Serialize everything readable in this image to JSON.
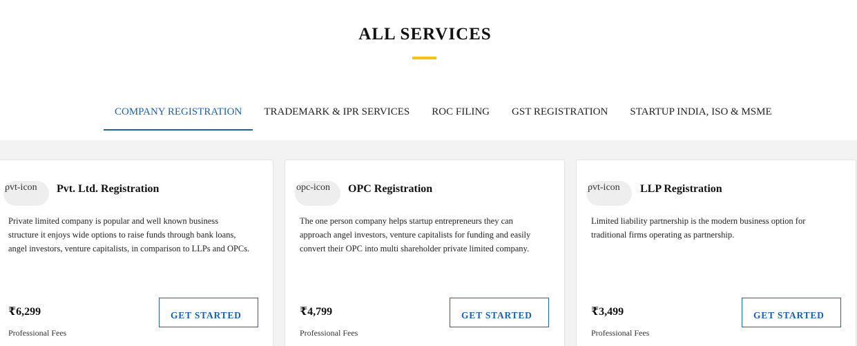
{
  "section": {
    "title": "ALL SERVICES",
    "accent_color": "#f5c400",
    "link_color": "#1a5fb4"
  },
  "tabs": [
    {
      "label": "COMPANY REGISTRATION",
      "active": true
    },
    {
      "label": "TRADEMARK & IPR SERVICES",
      "active": false
    },
    {
      "label": "ROC FILING",
      "active": false
    },
    {
      "label": "GST REGISTRATION",
      "active": false
    },
    {
      "label": "STARTUP INDIA, ISO & MSME",
      "active": false
    }
  ],
  "cards": [
    {
      "icon_alt": "pvt-icon",
      "title": "Pvt. Ltd. Registration",
      "description": "Private limited company is popular and well known business structure it enjoys wide options to raise funds through bank loans, angel investors, venture capitalists, in comparison to LLPs and OPCs.",
      "price": "₹6,299",
      "fees_label": "Professional Fees",
      "button_label": "GET STARTED"
    },
    {
      "icon_alt": "opc-icon",
      "title": "OPC Registration",
      "description": "The one person company helps startup entrepreneurs they can approach angel investors, venture capitalists for funding and easily convert their OPC into multi shareholder private limited company.",
      "price": "₹4,799",
      "fees_label": "Professional Fees",
      "button_label": "GET STARTED"
    },
    {
      "icon_alt": "pvt-icon",
      "title": "LLP Registration",
      "description": "Limited liability partnership is the modern business option for traditional firms operating as partnership.",
      "price": "₹3,499",
      "fees_label": "Professional Fees",
      "button_label": "GET STARTED"
    }
  ]
}
